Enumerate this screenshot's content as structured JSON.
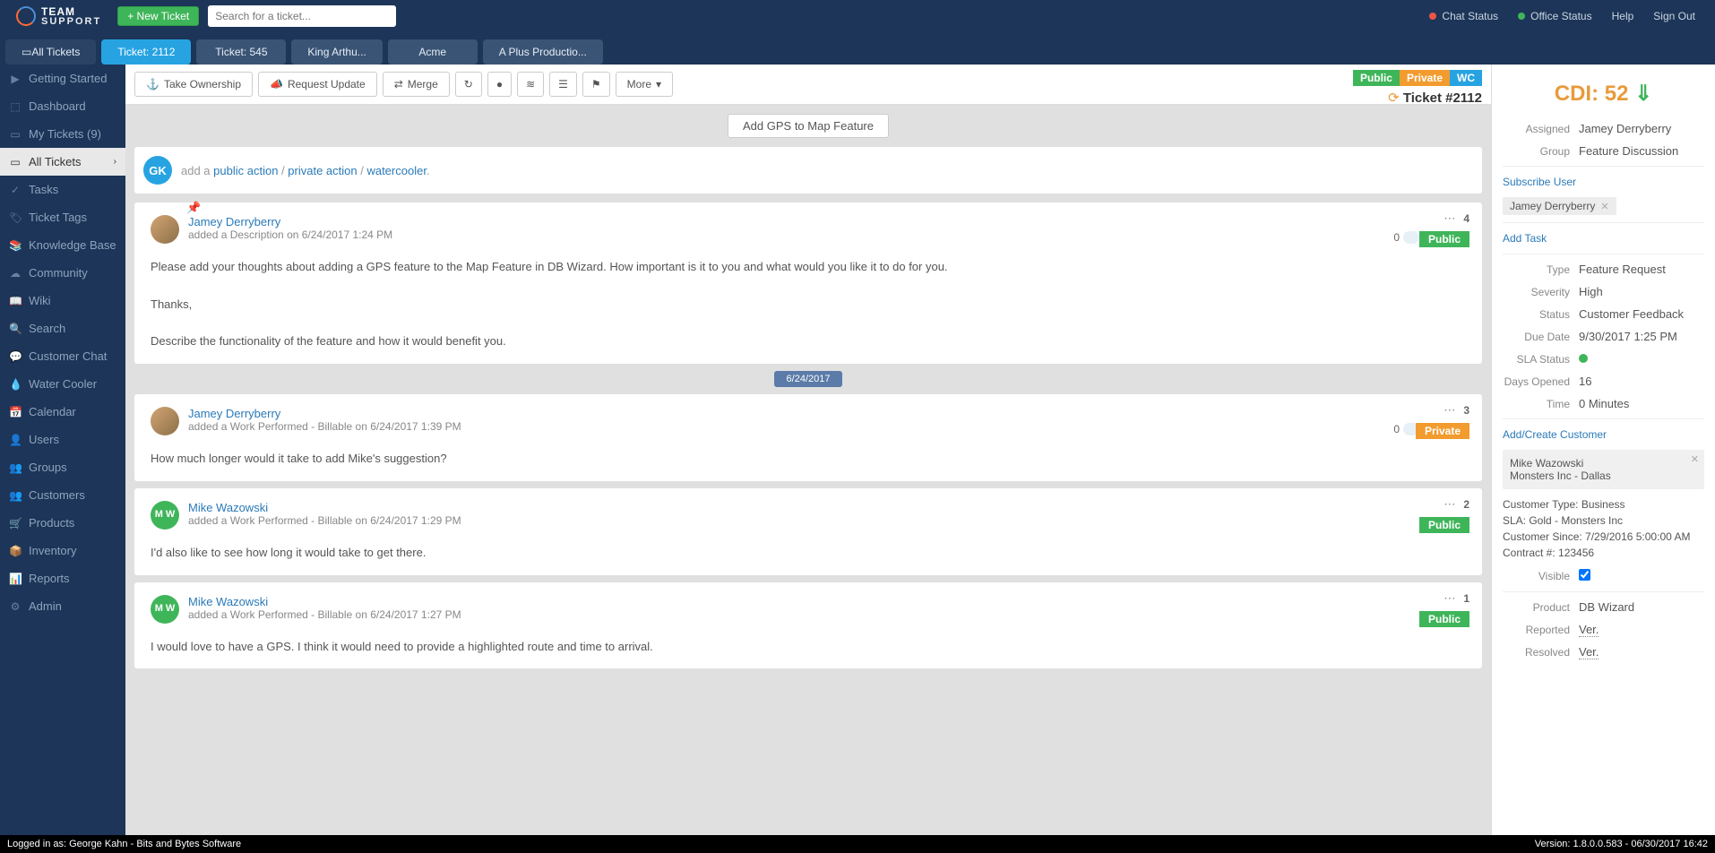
{
  "header": {
    "logo1": "TEAM",
    "logo2": "SUPPORT",
    "new_ticket": "+ New Ticket",
    "search_placeholder": "Search for a ticket...",
    "chat_status": "Chat Status",
    "office_status": "Office Status",
    "help": "Help",
    "sign_out": "Sign Out"
  },
  "tabs": [
    {
      "label": "All Tickets",
      "cls": "all"
    },
    {
      "label": "Ticket: 2112",
      "cls": "sel"
    },
    {
      "label": "Ticket: 545",
      "cls": ""
    },
    {
      "label": "King Arthu...",
      "cls": ""
    },
    {
      "label": "Acme",
      "cls": ""
    },
    {
      "label": "A Plus Productio...",
      "cls": ""
    }
  ],
  "sidebar": [
    {
      "label": "Getting Started",
      "icon": "▶"
    },
    {
      "label": "Dashboard",
      "icon": "⬚"
    },
    {
      "label": "My Tickets (9)",
      "icon": "▭"
    },
    {
      "label": "All Tickets",
      "icon": "▭",
      "active": true,
      "chev": "›"
    },
    {
      "label": "Tasks",
      "icon": "✓"
    },
    {
      "label": "Ticket Tags",
      "icon": "🏷"
    },
    {
      "label": "Knowledge Base",
      "icon": "📚"
    },
    {
      "label": "Community",
      "icon": "☁"
    },
    {
      "label": "Wiki",
      "icon": "📖"
    },
    {
      "label": "Search",
      "icon": "🔍"
    },
    {
      "label": "Customer Chat",
      "icon": "💬"
    },
    {
      "label": "Water Cooler",
      "icon": "💧"
    },
    {
      "label": "Calendar",
      "icon": "📅"
    },
    {
      "label": "Users",
      "icon": "👤"
    },
    {
      "label": "Groups",
      "icon": "👥"
    },
    {
      "label": "Customers",
      "icon": "👥"
    },
    {
      "label": "Products",
      "icon": "🛒"
    },
    {
      "label": "Inventory",
      "icon": "📦"
    },
    {
      "label": "Reports",
      "icon": "📊"
    },
    {
      "label": "Admin",
      "icon": "⚙"
    }
  ],
  "toolbar": {
    "take_ownership": "Take Ownership",
    "request_update": "Request Update",
    "merge": "Merge",
    "more": "More"
  },
  "badges": {
    "public": "Public",
    "private": "Private",
    "wc": "WC"
  },
  "ticket_number": "Ticket #2112",
  "ticket_title": "Add GPS to Map Feature",
  "compose": {
    "initials": "GK",
    "prefix": "add a ",
    "public": "public action",
    "private": "private action",
    "wc": "watercooler"
  },
  "date_sep": "6/24/2017",
  "posts": [
    {
      "author": "Jamey Derryberry",
      "meta": "added a Description on 6/24/2017 1:24 PM",
      "body": "Please add your thoughts about adding a GPS feature to the Map Feature in DB Wizard.  How important is it to you and what would you like it to do for you.\n\nThanks,\n\nDescribe the functionality of the feature and how it would benefit you.",
      "n": "4",
      "vote": "0",
      "badge": "Public",
      "bcls": "pub",
      "pin": true,
      "avatar": "img"
    },
    {
      "author": "Jamey Derryberry",
      "meta": "added a Work Performed - Billable on 6/24/2017 1:39 PM",
      "body": "How much longer would it take to add Mike's suggestion?",
      "n": "3",
      "vote": "0",
      "badge": "Private",
      "bcls": "priv",
      "avatar": "img"
    },
    {
      "author": "Mike Wazowski",
      "meta": "added a Work Performed - Billable on 6/24/2017 1:29 PM",
      "body": "I'd also like to see how long it would take to get there.",
      "n": "2",
      "badge": "Public",
      "bcls": "pub",
      "avatar": "mw",
      "initials": "M\nW"
    },
    {
      "author": "Mike Wazowski",
      "meta": "added a Work Performed - Billable on 6/24/2017 1:27 PM",
      "body": "I would love to have a GPS.  I think it would need to provide a highlighted route and time to arrival.",
      "n": "1",
      "badge": "Public",
      "bcls": "pub",
      "avatar": "mw",
      "initials": "M\nW"
    }
  ],
  "panel": {
    "cdi": "CDI: 52",
    "assigned_l": "Assigned",
    "assigned_v": "Jamey Derryberry",
    "group_l": "Group",
    "group_v": "Feature Discussion",
    "subscribe": "Subscribe User",
    "subscriber": "Jamey Derryberry",
    "add_task": "Add Task",
    "type_l": "Type",
    "type_v": "Feature Request",
    "severity_l": "Severity",
    "severity_v": "High",
    "status_l": "Status",
    "status_v": "Customer Feedback",
    "due_l": "Due Date",
    "due_v": "9/30/2017 1:25 PM",
    "sla_l": "SLA Status",
    "days_l": "Days Opened",
    "days_v": "16",
    "time_l": "Time",
    "time_v": "0 Minutes",
    "add_customer": "Add/Create Customer",
    "cust_name": "Mike Wazowski",
    "cust_co": "Monsters Inc - Dallas",
    "cust_type": "Customer Type: Business",
    "cust_sla": "SLA: Gold - Monsters Inc",
    "cust_since": "Customer Since: 7/29/2016 5:00:00 AM",
    "cust_contract": "Contract #: 123456",
    "visible_l": "Visible",
    "product_l": "Product",
    "product_v": "DB Wizard",
    "reported_l": "Reported",
    "reported_v": "Ver.",
    "resolved_l": "Resolved",
    "resolved_v": "Ver."
  },
  "statusbar": {
    "left": "Logged in as: George Kahn - Bits and Bytes Software",
    "right": "Version: 1.8.0.0.583 - 06/30/2017 16:42"
  }
}
